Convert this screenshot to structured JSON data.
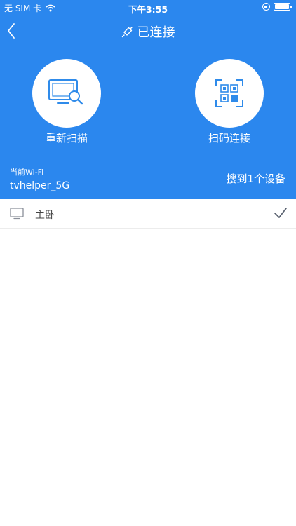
{
  "status_bar": {
    "carrier": "无 SIM 卡",
    "time": "下午3:55"
  },
  "nav": {
    "title": "已连接",
    "back_icon": "chevron-left-icon",
    "title_icon": "link-icon"
  },
  "actions": [
    {
      "label": "重新扫描",
      "icon": "monitor-search-icon"
    },
    {
      "label": "扫码连接",
      "icon": "qr-scan-icon"
    }
  ],
  "wifi": {
    "caption": "当前Wi-Fi",
    "name": "tvhelper_5G",
    "device_count_text": "搜到1个设备"
  },
  "devices": [
    {
      "name": "主卧",
      "icon": "tv-icon",
      "selected": true
    }
  ],
  "colors": {
    "primary": "#2b87ee",
    "icon_blue": "#2f8bea",
    "background": "#ffffff"
  }
}
